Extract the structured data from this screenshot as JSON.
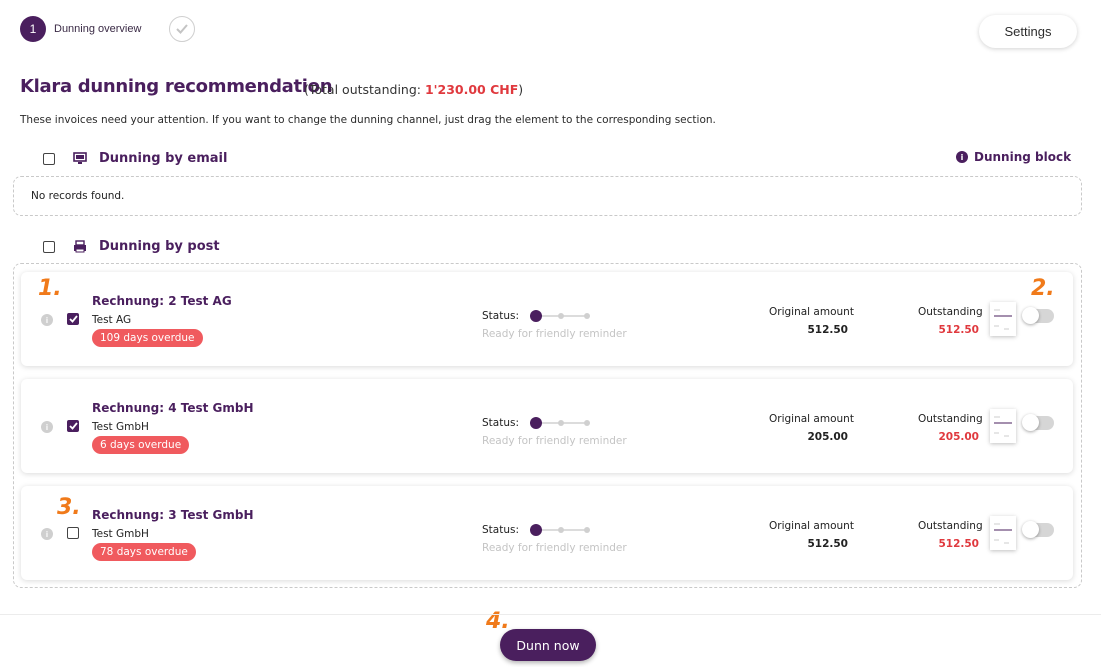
{
  "stepper": {
    "step1_number": "1",
    "step1_label": "Dunning overview"
  },
  "header": {
    "settings_label": "Settings",
    "title": "Klara dunning recommendation",
    "total_prefix": "(Total outstanding: ",
    "total_amount": "1'230.00 CHF",
    "total_suffix": ")",
    "intro": "These invoices need your attention. If you want to change the dunning channel, just drag the element to the corresponding section."
  },
  "email_section": {
    "title": "Dunning by email",
    "icon": "monitor-icon",
    "block_label": "Dunning block",
    "empty_text": "No records found."
  },
  "post_section": {
    "title": "Dunning by post",
    "icon": "printer-icon"
  },
  "invoices": [
    {
      "title": "Rechnung: 2 Test AG",
      "company": "Test AG",
      "overdue": "109 days overdue",
      "checked": true,
      "status_label": "Status:",
      "status_text": "Ready for friendly reminder",
      "status_step": 1,
      "original_label": "Original amount",
      "original_amount": "512.50",
      "outstanding_label": "Outstanding",
      "outstanding_amount": "512.50",
      "toggle_on": false
    },
    {
      "title": "Rechnung: 4 Test GmbH",
      "company": "Test GmbH",
      "overdue": "6 days overdue",
      "checked": true,
      "status_label": "Status:",
      "status_text": "Ready for friendly reminder",
      "status_step": 1,
      "original_label": "Original amount",
      "original_amount": "205.00",
      "outstanding_label": "Outstanding",
      "outstanding_amount": "205.00",
      "toggle_on": false
    },
    {
      "title": "Rechnung: 3 Test GmbH",
      "company": "Test GmbH",
      "overdue": "78 days overdue",
      "checked": false,
      "status_label": "Status:",
      "status_text": "Ready for friendly reminder",
      "status_step": 1,
      "original_label": "Original amount",
      "original_amount": "512.50",
      "outstanding_label": "Outstanding",
      "outstanding_amount": "512.50",
      "toggle_on": false
    }
  ],
  "annotations": {
    "a1": "1.",
    "a2": "2.",
    "a3": "3.",
    "a4": "4."
  },
  "footer": {
    "dunn_label": "Dunn now"
  },
  "colors": {
    "brand": "#4a1f5e",
    "accent_red": "#e0393e",
    "badge": "#f05a5e",
    "annotation": "#f07a1a"
  }
}
